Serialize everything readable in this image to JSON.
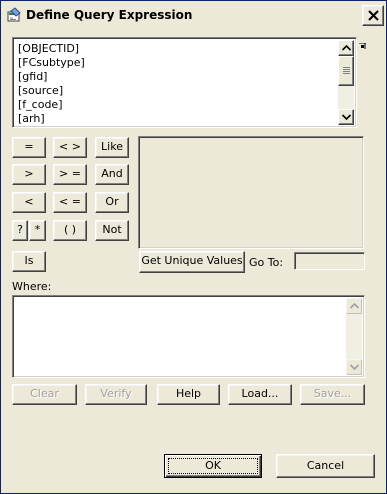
{
  "window": {
    "title": "Define Query Expression",
    "icon": "query-builder-icon",
    "close_icon": "close-icon"
  },
  "fields": {
    "items": [
      "[OBJECTID]",
      "[FCsubtype]",
      "[gfid]",
      "[source]",
      "[f_code]",
      "[arh]"
    ]
  },
  "operators": {
    "eq": "=",
    "neq": "< >",
    "like": "Like",
    "gt": ">",
    "gte": "> =",
    "and": "And",
    "lt": "<",
    "lte": "< =",
    "or": "Or",
    "wildcard_q": "?",
    "wildcard_star": "*",
    "parens": "( )",
    "not": "Not",
    "is": "Is"
  },
  "unique_values": {
    "button": "Get Unique Values",
    "goto_label": "Go To:",
    "goto_value": ""
  },
  "where": {
    "label": "Where:",
    "value": ""
  },
  "actions": {
    "clear": "Clear",
    "verify": "Verify",
    "help": "Help",
    "load": "Load...",
    "save": "Save..."
  },
  "footer": {
    "ok": "OK",
    "cancel": "Cancel"
  },
  "colors": {
    "face": "#ece9d8",
    "disabled_text": "#a0a0a0",
    "window_border": "#0a246a"
  }
}
